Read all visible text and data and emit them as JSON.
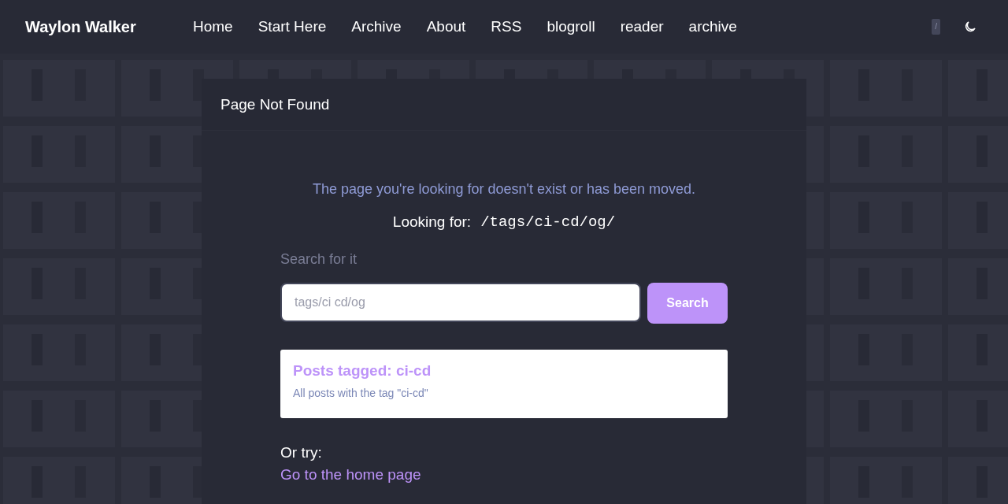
{
  "header": {
    "site_title": "Waylon Walker",
    "nav": [
      {
        "label": "Home"
      },
      {
        "label": "Start Here"
      },
      {
        "label": "Archive"
      },
      {
        "label": "About"
      },
      {
        "label": "RSS"
      },
      {
        "label": "blogroll"
      },
      {
        "label": "reader"
      },
      {
        "label": "archive"
      }
    ],
    "search_key": "/"
  },
  "card": {
    "title": "Page Not Found",
    "message": "The page you're looking for doesn't exist or has been moved.",
    "looking_for_label": "Looking for:",
    "looking_for_path": "/tags/ci-cd/og/",
    "search_label": "Search for it",
    "search_field": {
      "placeholder": "tags/ci cd/og"
    },
    "search_button": "Search",
    "results": [
      {
        "title": "Posts tagged: ci-cd",
        "description": "All posts with the tag \"ci-cd\""
      }
    ],
    "or_try": "Or try:",
    "links": [
      "Go to the home page"
    ]
  }
}
